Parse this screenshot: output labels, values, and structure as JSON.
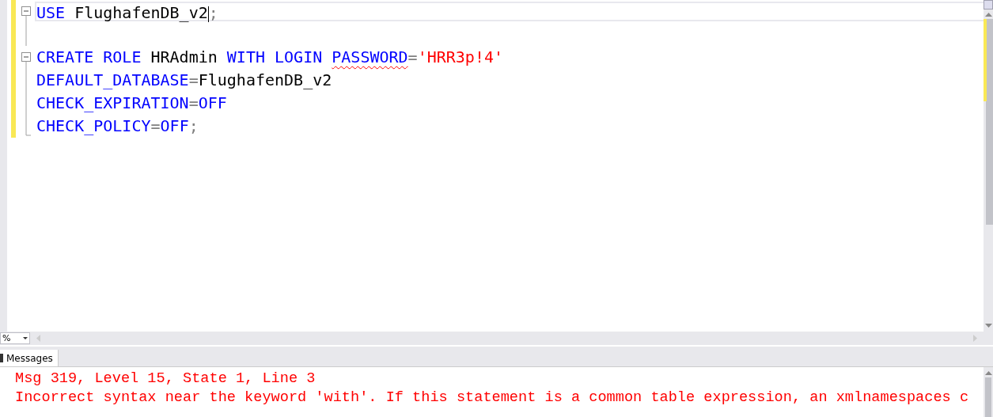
{
  "editor": {
    "lines": [
      {
        "kind": "start",
        "changed": true,
        "current": true,
        "tokens": [
          {
            "kind": "keyword",
            "text": "USE"
          },
          {
            "kind": "plain",
            "text": " FlughafenDB_v2"
          },
          {
            "kind": "caret"
          },
          {
            "kind": "operator",
            "text": ";"
          }
        ]
      },
      {
        "kind": "continue",
        "changed": true,
        "current": false
      },
      {
        "kind": "start",
        "changed": true,
        "current": false,
        "tokens": [
          {
            "kind": "keyword",
            "text": "CREATE ROLE"
          },
          {
            "kind": "plain",
            "text": " HRAdmin "
          },
          {
            "kind": "keyword",
            "text": "WITH LOGIN "
          },
          {
            "kind": "keyword",
            "text": "PASSWORD",
            "squiggle": true
          },
          {
            "kind": "operator",
            "text": "="
          },
          {
            "kind": "string",
            "text": "'HRR3p!4'"
          }
        ]
      },
      {
        "kind": "continue",
        "changed": true,
        "current": false,
        "tokens": [
          {
            "kind": "keyword",
            "text": "DEFAULT_DATABASE"
          },
          {
            "kind": "operator",
            "text": "="
          },
          {
            "kind": "plain",
            "text": "FlughafenDB_v2"
          }
        ]
      },
      {
        "kind": "continue",
        "changed": true,
        "current": false,
        "tokens": [
          {
            "kind": "keyword",
            "text": "CHECK_EXPIRATION"
          },
          {
            "kind": "operator",
            "text": "="
          },
          {
            "kind": "keyword",
            "text": "OFF"
          }
        ]
      },
      {
        "kind": "end",
        "changed": true,
        "current": false,
        "tokens": [
          {
            "kind": "keyword",
            "text": "CHECK_POLICY"
          },
          {
            "kind": "operator",
            "text": "="
          },
          {
            "kind": "keyword",
            "text": "OFF"
          },
          {
            "kind": "operator",
            "text": ";"
          }
        ]
      }
    ]
  },
  "zoom": {
    "value": "%"
  },
  "results": {
    "tabs": [
      {
        "label": "Messages",
        "selected": true
      }
    ],
    "messages": [
      "Msg 319, Level 15, State 1, Line 3",
      "Incorrect syntax near the keyword 'with'. If this statement is a common table expression, an xmlnamespaces c"
    ]
  }
}
